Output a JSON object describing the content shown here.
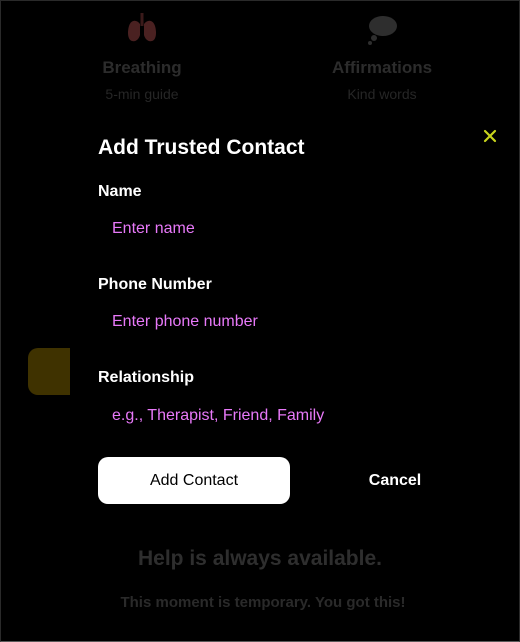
{
  "background": {
    "cards": [
      {
        "icon": "lungs-icon",
        "title": "Breathing",
        "subtitle": "5-min guide"
      },
      {
        "icon": "thought-bubble-icon",
        "title": "Affirmations",
        "subtitle": "Kind words"
      }
    ],
    "help_text": "Help is always available.",
    "temporary_text": "This moment is temporary. You got this!"
  },
  "modal": {
    "title": "Add Trusted Contact",
    "close_icon": "close-icon",
    "fields": {
      "name": {
        "label": "Name",
        "placeholder": "Enter name",
        "value": ""
      },
      "phone": {
        "label": "Phone Number",
        "placeholder": "Enter phone number",
        "value": ""
      },
      "relationship": {
        "label": "Relationship",
        "placeholder": "e.g., Therapist, Friend, Family",
        "value": ""
      }
    },
    "add_label": "Add Contact",
    "cancel_label": "Cancel"
  },
  "colors": {
    "background": "#000000",
    "placeholder": "#e879f9",
    "close_icon": "#c8d41c",
    "primary_button_bg": "#ffffff",
    "primary_button_text": "#000000",
    "accent_dim": "#3f3200"
  }
}
